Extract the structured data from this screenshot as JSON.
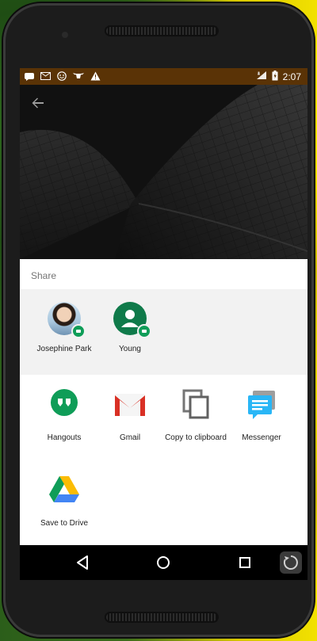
{
  "status_bar": {
    "time": "2:07",
    "notification_icons": [
      "chat-bubble-icon",
      "gmail-icon",
      "smiley-icon",
      "bull-icon",
      "warning-icon"
    ],
    "battery_label": "battery-charging-icon",
    "signal_label": "signal-icon"
  },
  "share_sheet": {
    "title": "Share",
    "direct_share": [
      {
        "name": "Josephine Park",
        "icon": "contact-photo",
        "badge": "hangouts-icon"
      },
      {
        "name": "Young",
        "icon": "contact-avatar-default",
        "badge": "hangouts-icon"
      }
    ],
    "apps": [
      {
        "name": "Hangouts",
        "icon": "hangouts-icon",
        "color": "#0f9d58"
      },
      {
        "name": "Gmail",
        "icon": "gmail-icon",
        "color": "#d93025"
      },
      {
        "name": "Copy to clipboard",
        "icon": "copy-icon",
        "color": "#616161"
      },
      {
        "name": "Messenger",
        "icon": "messenger-icon",
        "color": "#1e88e5"
      },
      {
        "name": "Save to Drive",
        "icon": "drive-icon",
        "color": "#4285f4"
      }
    ]
  },
  "navigation": {
    "back": "back-icon",
    "home": "home-icon",
    "recents": "recents-icon",
    "assistant": "rotate-icon"
  },
  "colors": {
    "status_bar_bg": "#5a3306",
    "sheet_bg": "#ffffff",
    "direct_share_bg": "#f2f2f2",
    "nav_bg": "#000000"
  }
}
